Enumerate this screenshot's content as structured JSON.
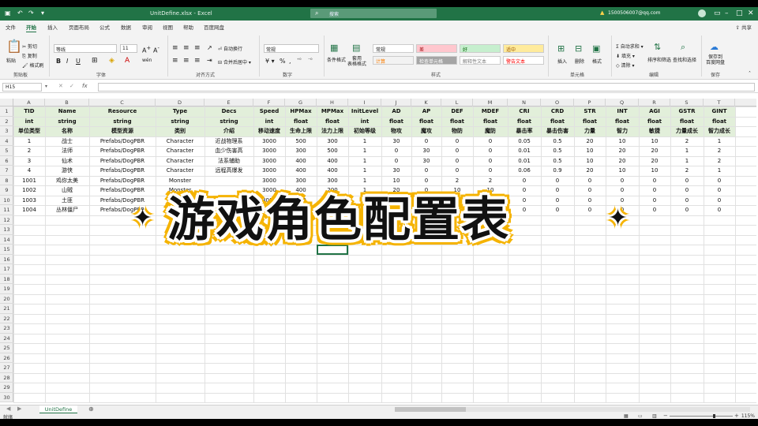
{
  "window": {
    "title": "UnitDefine.xlsx  -  Excel",
    "search_placeholder": "搜索",
    "account": "1500506007@qq.com"
  },
  "ribbon": {
    "tabs": [
      "文件",
      "开始",
      "插入",
      "页面布局",
      "公式",
      "数据",
      "审阅",
      "视图",
      "帮助",
      "百度网盘"
    ],
    "active_tab": "开始",
    "share": "共享",
    "clipboard": {
      "paste": "粘贴",
      "cut": "剪切",
      "copy": "复制",
      "format_painter": "格式刷",
      "label": "剪贴板"
    },
    "font": {
      "name": "等线",
      "size": "11",
      "label": "字体"
    },
    "alignment": {
      "wrap": "自动换行",
      "merge": "合并后居中",
      "label": "对齐方式"
    },
    "number": {
      "format": "常规",
      "label": "数字"
    },
    "styles": {
      "conditional": "条件格式",
      "table": "套用\n表格格式",
      "cells": [
        {
          "text": "常规",
          "bg": "#ffffff",
          "fg": "#222222"
        },
        {
          "text": "差",
          "bg": "#ffc7ce",
          "fg": "#9c0006"
        },
        {
          "text": "好",
          "bg": "#c6efce",
          "fg": "#006100"
        },
        {
          "text": "适中",
          "bg": "#ffeb9c",
          "fg": "#9c5700"
        },
        {
          "text": "计算",
          "bg": "#f2f2f2",
          "fg": "#fa7d00"
        },
        {
          "text": "检查单元格",
          "bg": "#a5a5a5",
          "fg": "#ffffff"
        },
        {
          "text": "解释性文本",
          "bg": "#ffffff",
          "fg": "#7f7f7f"
        },
        {
          "text": "警告文本",
          "bg": "#ffffff",
          "fg": "#ff0000"
        }
      ],
      "label": "样式"
    },
    "cells_group": {
      "insert": "插入",
      "delete": "删除",
      "format": "格式",
      "label": "单元格"
    },
    "editing": {
      "autosum": "自动求和",
      "fill": "填充",
      "clear": "清除",
      "sort": "排序和筛选",
      "find": "查找和选择",
      "label": "编辑"
    },
    "save": {
      "btn": "保存到\n百度网盘",
      "label": "保存"
    }
  },
  "formula_bar": {
    "name_box": "H15",
    "fx": "fx",
    "value": ""
  },
  "grid": {
    "columns": [
      "A",
      "B",
      "C",
      "D",
      "E",
      "F",
      "G",
      "H",
      "I",
      "J",
      "K",
      "L",
      "M",
      "N",
      "O",
      "P",
      "Q",
      "R",
      "S",
      "T"
    ],
    "row_count": 30,
    "header_rows": [
      [
        "TID",
        "Name",
        "Resource",
        "Type",
        "Decs",
        "Speed",
        "HPMax",
        "MPMax",
        "InitLevel",
        "AD",
        "AP",
        "DEF",
        "MDEF",
        "CRI",
        "CRD",
        "STR",
        "INT",
        "AGI",
        "GSTR",
        "GINT"
      ],
      [
        "int",
        "string",
        "string",
        "string",
        "string",
        "int",
        "float",
        "float",
        "int",
        "float",
        "float",
        "float",
        "float",
        "float",
        "float",
        "float",
        "float",
        "float",
        "float",
        "float"
      ],
      [
        "单位类型",
        "名称",
        "模型资源",
        "类别",
        "介绍",
        "移动速度",
        "生命上限",
        "法力上限",
        "初始等级",
        "物攻",
        "魔攻",
        "物防",
        "魔防",
        "暴击率",
        "暴击伤害",
        "力量",
        "智力",
        "敏捷",
        "力量成长",
        "智力成长"
      ]
    ],
    "data_rows": [
      [
        "1",
        "战士",
        "Prefabs/DogPBR",
        "Character",
        "近战物理系",
        "3000",
        "500",
        "300",
        "1",
        "30",
        "0",
        "0",
        "0",
        "0.05",
        "0.5",
        "20",
        "10",
        "10",
        "2",
        "1"
      ],
      [
        "2",
        "法师",
        "Prefabs/DogPBR",
        "Character",
        "血少伤害高",
        "3000",
        "300",
        "500",
        "1",
        "0",
        "30",
        "0",
        "0",
        "0.01",
        "0.5",
        "10",
        "20",
        "20",
        "1",
        "2"
      ],
      [
        "3",
        "仙术",
        "Prefabs/DogPBR",
        "Character",
        "法系辅助",
        "3000",
        "400",
        "400",
        "1",
        "0",
        "30",
        "0",
        "0",
        "0.01",
        "0.5",
        "10",
        "20",
        "20",
        "1",
        "2"
      ],
      [
        "4",
        "游侠",
        "Prefabs/DogPBR",
        "Character",
        "远程高爆发",
        "3000",
        "400",
        "400",
        "1",
        "30",
        "0",
        "0",
        "0",
        "0.06",
        "0.9",
        "20",
        "10",
        "10",
        "2",
        "1"
      ],
      [
        "1001",
        "鸡你太美",
        "Prefabs/DogPBR",
        "Monster",
        "",
        "3000",
        "300",
        "300",
        "1",
        "10",
        "0",
        "2",
        "2",
        "0",
        "0",
        "0",
        "0",
        "0",
        "0",
        "0"
      ],
      [
        "1002",
        "山贼",
        "Prefabs/DogPBR",
        "Monster",
        "",
        "3000",
        "400",
        "200",
        "1",
        "20",
        "0",
        "10",
        "10",
        "0",
        "0",
        "0",
        "0",
        "0",
        "0",
        "0"
      ],
      [
        "1003",
        "土匪",
        "Prefabs/DogPBR",
        "Monster",
        "",
        "3000",
        "400",
        "200",
        "1",
        "20",
        "0",
        "10",
        "10",
        "0",
        "0",
        "0",
        "0",
        "0",
        "0",
        "0"
      ],
      [
        "1004",
        "丛林僵尸",
        "Prefabs/DogPBR",
        "Monster",
        "",
        "3000",
        "400",
        "200",
        "1",
        "20",
        "0",
        "10",
        "10",
        "0",
        "0",
        "0",
        "0",
        "0",
        "0",
        "0"
      ]
    ]
  },
  "sheet_tabs": [
    "UnitDefine"
  ],
  "status": {
    "ready": "就绪",
    "zoom": "115%"
  },
  "overlay": {
    "title": "游戏角色配置表",
    "spark": "✦"
  }
}
